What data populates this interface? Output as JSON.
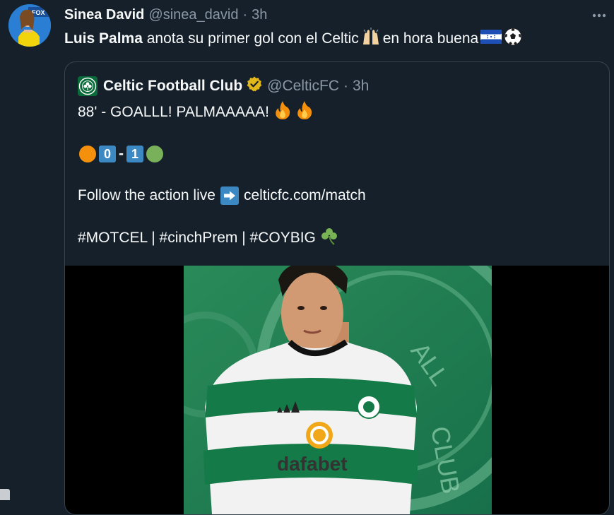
{
  "tweet": {
    "author_name": "Sinea David",
    "author_handle": "@sinea_david",
    "separator": "·",
    "time": "3h",
    "more_icon": "more-horizontal-icon",
    "text_bold": "Luis Palma",
    "text_part1": "anota su primer gol con el Celtic",
    "text_part2": "en hora buena",
    "emojis": [
      "raising-hands-emoji",
      "honduras-flag-emoji",
      "soccer-ball-emoji"
    ]
  },
  "quote": {
    "author_name": "Celtic Football Club",
    "author_handle": "@CelticFC",
    "separator": "·",
    "time": "3h",
    "verified_icon": "gold-verified-badge-icon",
    "line1": "88' - GOALLL! PALMAAAAA!",
    "score_left": "0",
    "score_dash": "-",
    "score_right": "1",
    "line3_text": "Follow the action live",
    "line3_link": "celticfc.com/match",
    "hashtags": "#MOTCEL | #cinchPrem | #COYBIG",
    "media": {
      "kit_sponsor": "dafabet"
    },
    "colors": {
      "home_dot": "#f4900c",
      "away_dot": "#78b159",
      "score_box": "#3b88c3",
      "celtic_green": "#0a6b3a"
    }
  },
  "theme": {
    "background": "#15202b",
    "text": "#f7f9f9",
    "secondary": "#8b98a5",
    "border": "#38444d"
  }
}
